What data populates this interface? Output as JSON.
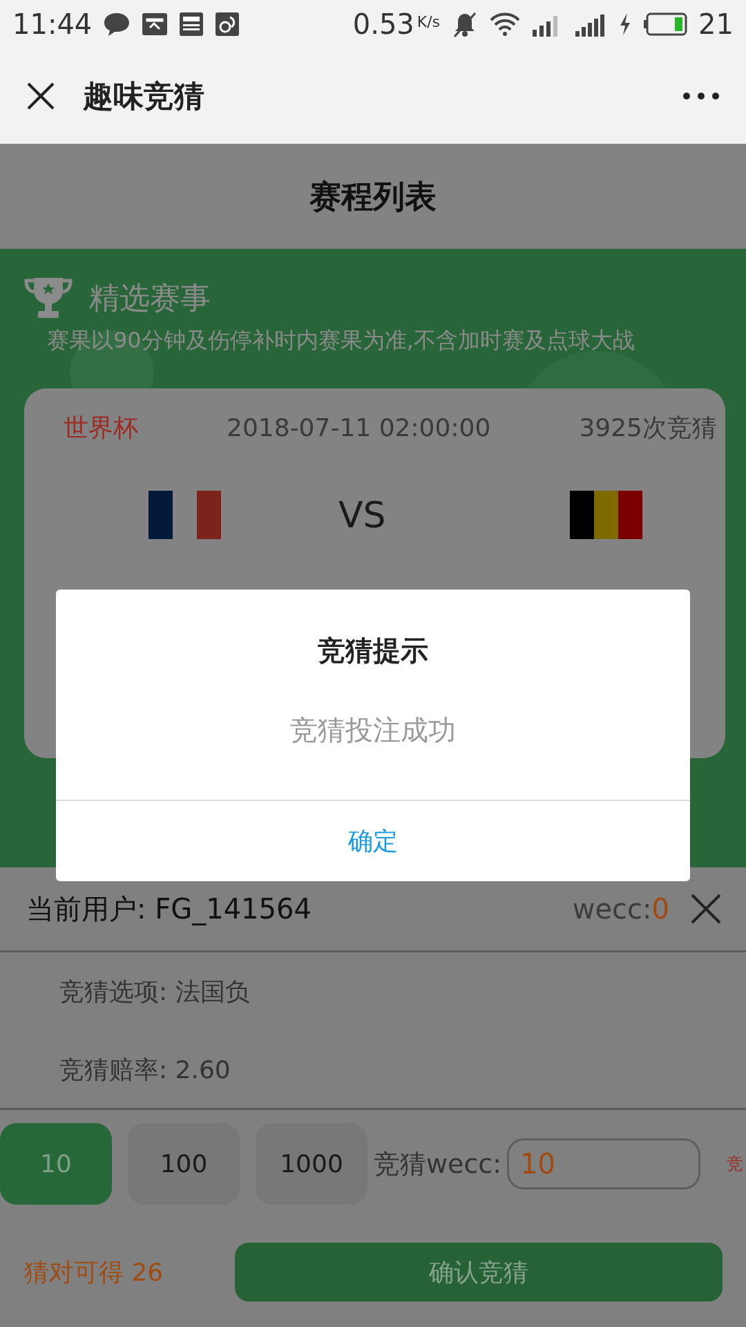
{
  "status_bar": {
    "time": "11:44",
    "net_speed": "0.53",
    "speed_unit": "K/s",
    "battery": "21"
  },
  "nav": {
    "title": "趣味竞猜"
  },
  "page_title": "赛程列表",
  "section": {
    "title": "精选赛事",
    "note": "赛果以90分钟及伤停补时内赛果为准,不含加时赛及点球大战"
  },
  "match": {
    "league": "世界杯",
    "time": "2018-07-11 02:00:00",
    "count": "3925次竞猜",
    "vs": "VS"
  },
  "dialog": {
    "title": "竞猜提示",
    "message": "竞猜投注成功",
    "button": "确定"
  },
  "bet_sheet": {
    "user": "当前用户: FG_141564",
    "balance_label": "wecc:",
    "balance": "0",
    "option": "竞猜选项:  法国负",
    "odds": "竞猜赔率:   2.60",
    "amounts": [
      {
        "label": "10",
        "selected": true
      },
      {
        "label": "100",
        "selected": false
      },
      {
        "label": "1000",
        "selected": false
      }
    ],
    "amount_label": "竞猜wecc:",
    "amount_value": "10",
    "cut_text": "竞",
    "payout": "猜对可得 26",
    "confirm": "确认竞猜"
  }
}
